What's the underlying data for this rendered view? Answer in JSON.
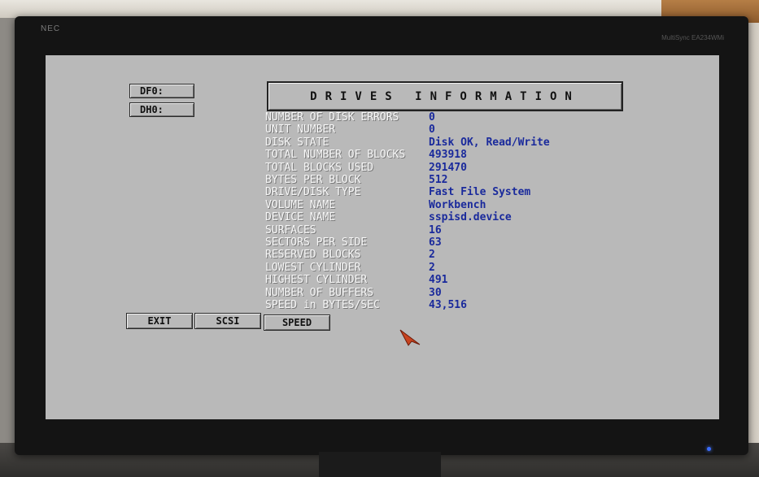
{
  "monitor": {
    "brand": "NEC",
    "model": "MultiSync EA234WMi"
  },
  "drives": [
    "DF0:",
    "DH0:"
  ],
  "title": "DRIVES INFORMATION",
  "info": [
    {
      "label": "NUMBER OF DISK ERRORS",
      "value": "0"
    },
    {
      "label": "UNIT NUMBER",
      "value": "0"
    },
    {
      "label": "DISK STATE",
      "value": "Disk OK, Read/Write"
    },
    {
      "label": "TOTAL NUMBER OF BLOCKS",
      "value": "493918"
    },
    {
      "label": "TOTAL BLOCKS USED",
      "value": "291470"
    },
    {
      "label": "BYTES PER BLOCK",
      "value": "512"
    },
    {
      "label": "DRIVE/DISK TYPE",
      "value": "Fast File System"
    },
    {
      "label": "VOLUME NAME",
      "value": "Workbench"
    },
    {
      "label": "DEVICE NAME",
      "value": "sspisd.device"
    },
    {
      "label": "SURFACES",
      "value": "16"
    },
    {
      "label": "SECTORS PER SIDE",
      "value": "63"
    },
    {
      "label": "RESERVED BLOCKS",
      "value": "2"
    },
    {
      "label": "LOWEST CYLINDER",
      "value": "2"
    },
    {
      "label": "HIGHEST CYLINDER",
      "value": "491"
    },
    {
      "label": "NUMBER OF BUFFERS",
      "value": "30"
    },
    {
      "label": "SPEED in BYTES/SEC",
      "value": "43,516"
    }
  ],
  "buttons": {
    "exit": "EXIT",
    "scsi": "SCSI",
    "speed": "SPEED"
  },
  "icons": {
    "pointer": "mouse-pointer-icon",
    "pointer_color": "#c8431f"
  }
}
